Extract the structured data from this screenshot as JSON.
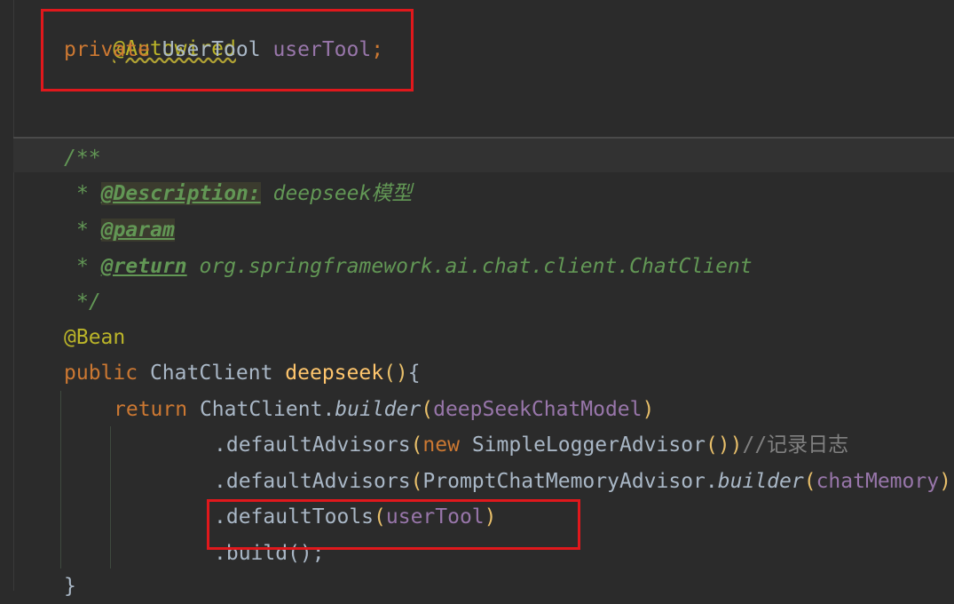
{
  "code": {
    "autowired": "@Autowired",
    "private_kw": "private",
    "type_usertool": "UserTool",
    "field_usertool": "userTool",
    "semicolon": ";",
    "doc_open": "/**",
    "doc_star": "*",
    "desc_tag": "@Description:",
    "desc_text": "deepseek模型",
    "param_tag": "@param",
    "return_tag": "@return",
    "return_text": "org.springframework.ai.chat.client.ChatClient",
    "doc_close": "*/",
    "bean": "@Bean",
    "public_kw": "public",
    "type_chatclient": "ChatClient",
    "method_name": "deepseek",
    "parens": "()",
    "brace_open": "{",
    "return_kw": "return",
    "chatclient_ref": "ChatClient",
    "dot": ".",
    "builder": "builder",
    "paren_open": "(",
    "deepseek_model": "deepSeekChatModel",
    "paren_close": ")",
    "default_advisors": ".defaultAdvisors",
    "new_kw": "new",
    "simple_logger": "SimpleLoggerAdvisor",
    "close_parens": "())",
    "comment_log": "//记录日志",
    "prompt_advisor": "PromptChatMemoryAdvisor",
    "chat_memory": "chatMemory",
    "default_tools": ".defaultTools",
    "build_call": ".build();",
    "brace_close": "}"
  }
}
